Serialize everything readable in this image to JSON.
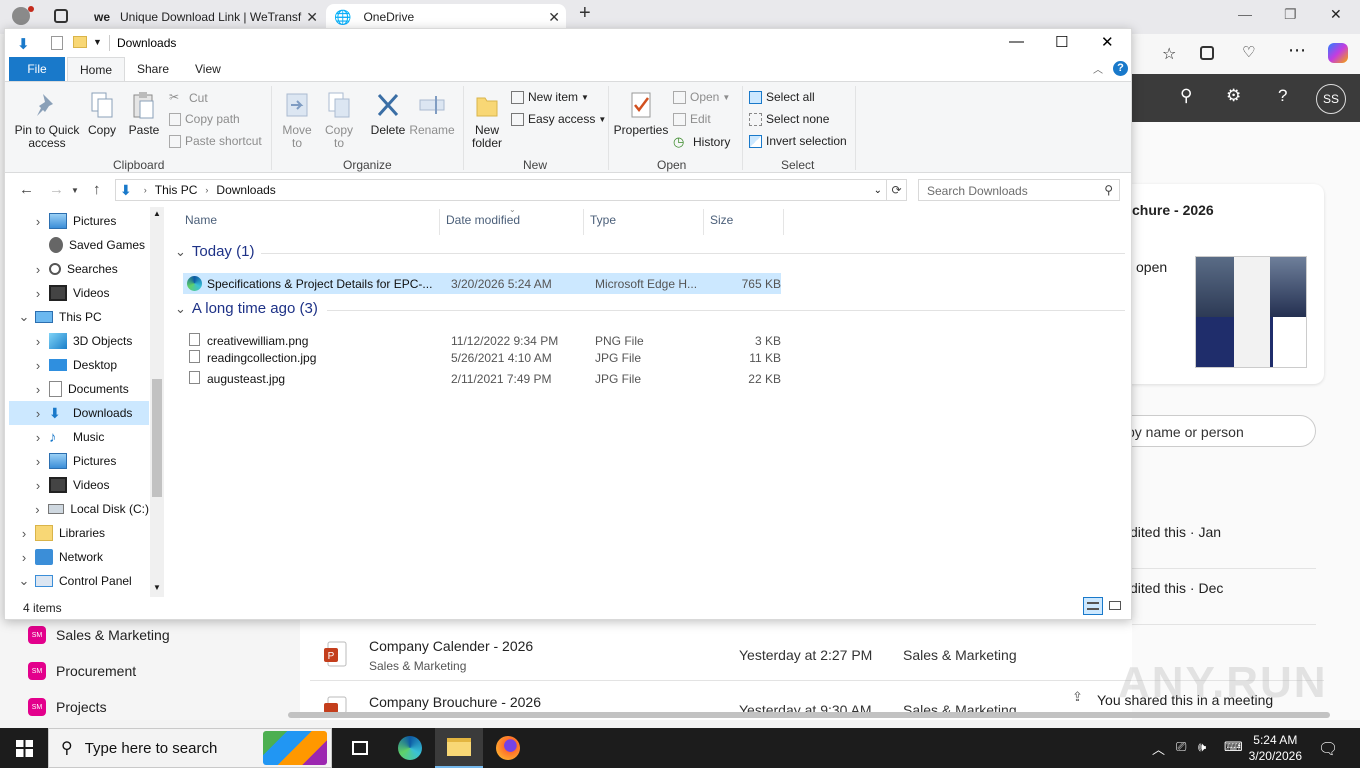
{
  "browser": {
    "tabs": [
      {
        "title": "Unique Download Link | WeTransf",
        "logo": "we"
      },
      {
        "title": "OneDrive"
      }
    ],
    "new_tab": "+",
    "window_controls": [
      "—",
      "❐",
      "✕"
    ]
  },
  "onedrive": {
    "avatar": "SS",
    "card_title": "chure - 2026",
    "card_action": "open",
    "search_placeholder": "by name or person",
    "activity": [
      "dited this · Jan",
      "dited this · Dec"
    ],
    "nav": [
      {
        "badge": "SM",
        "label": "Sales & Marketing"
      },
      {
        "badge": "SM",
        "label": "Procurement"
      },
      {
        "badge": "SM",
        "label": "Projects"
      }
    ],
    "files": [
      {
        "name": "Company Calender - 2026",
        "location": "Sales & Marketing",
        "modified": "Yesterday at 2:27 PM",
        "site": "Sales & Marketing"
      },
      {
        "name": "Company Brouchure - 2026",
        "location": "",
        "modified": "Yesterday at 9:30 AM",
        "site": "Sales & Marketing"
      }
    ],
    "shared_note": "You shared this in a meeting"
  },
  "explorer": {
    "title": "Downloads",
    "window_controls": [
      "—",
      "☐",
      "✕"
    ],
    "ribbon_tabs": [
      "File",
      "Home",
      "Share",
      "View"
    ],
    "ribbon": {
      "clipboard": {
        "label": "Clipboard",
        "pin": "Pin to Quick access",
        "copy": "Copy",
        "paste": "Paste",
        "cut": "Cut",
        "copy_path": "Copy path",
        "paste_shortcut": "Paste shortcut"
      },
      "organize": {
        "label": "Organize",
        "move_to": "Move to",
        "copy_to": "Copy to",
        "delete": "Delete",
        "rename": "Rename"
      },
      "new": {
        "label": "New",
        "new_folder": "New folder",
        "new_item": "New item",
        "easy_access": "Easy access"
      },
      "open": {
        "label": "Open",
        "properties": "Properties",
        "open": "Open",
        "edit": "Edit",
        "history": "History"
      },
      "select": {
        "label": "Select",
        "select_all": "Select all",
        "select_none": "Select none",
        "invert_selection": "Invert selection"
      }
    },
    "address": {
      "crumbs": [
        "This PC",
        "Downloads"
      ],
      "search_placeholder": "Search Downloads"
    },
    "nav_pane": [
      {
        "label": "Pictures",
        "indent": 1,
        "expander": true,
        "icon": "pictures"
      },
      {
        "label": "Saved Games",
        "indent": 1,
        "expander": false,
        "icon": "games"
      },
      {
        "label": "Searches",
        "indent": 1,
        "expander": true,
        "icon": "search"
      },
      {
        "label": "Videos",
        "indent": 1,
        "expander": true,
        "icon": "videos"
      },
      {
        "label": "This PC",
        "indent": 0,
        "expander": "open",
        "icon": "pc"
      },
      {
        "label": "3D Objects",
        "indent": 1,
        "expander": true,
        "icon": "3d"
      },
      {
        "label": "Desktop",
        "indent": 1,
        "expander": true,
        "icon": "desktop"
      },
      {
        "label": "Documents",
        "indent": 1,
        "expander": true,
        "icon": "documents"
      },
      {
        "label": "Downloads",
        "indent": 1,
        "expander": true,
        "icon": "downloads",
        "selected": true
      },
      {
        "label": "Music",
        "indent": 1,
        "expander": true,
        "icon": "music"
      },
      {
        "label": "Pictures",
        "indent": 1,
        "expander": true,
        "icon": "pictures"
      },
      {
        "label": "Videos",
        "indent": 1,
        "expander": true,
        "icon": "videos"
      },
      {
        "label": "Local Disk (C:)",
        "indent": 1,
        "expander": true,
        "icon": "disk"
      },
      {
        "label": "Libraries",
        "indent": 0,
        "expander": true,
        "icon": "libraries"
      },
      {
        "label": "Network",
        "indent": 0,
        "expander": true,
        "icon": "network"
      },
      {
        "label": "Control Panel",
        "indent": 0,
        "expander": "open",
        "icon": "control"
      }
    ],
    "columns": [
      "Name",
      "Date modified",
      "Type",
      "Size"
    ],
    "groups": [
      {
        "title": "Today (1)",
        "files": [
          {
            "name": "Specifications & Project Details for  EPC-...",
            "date": "3/20/2026 5:24 AM",
            "type": "Microsoft Edge H...",
            "size": "765 KB",
            "icon": "edge",
            "selected": true
          }
        ]
      },
      {
        "title": "A long time ago (3)",
        "files": [
          {
            "name": "creativewilliam.png",
            "date": "11/12/2022 9:34 PM",
            "type": "PNG File",
            "size": "3 KB",
            "icon": "file"
          },
          {
            "name": "readingcollection.jpg",
            "date": "5/26/2021 4:10 AM",
            "type": "JPG File",
            "size": "11 KB",
            "icon": "file"
          },
          {
            "name": "augusteast.jpg",
            "date": "2/11/2021 7:49 PM",
            "type": "JPG File",
            "size": "22 KB",
            "icon": "file"
          }
        ]
      }
    ],
    "status": "4 items"
  },
  "taskbar": {
    "search_placeholder": "Type here to search",
    "time": "5:24 AM",
    "date": "3/20/2026"
  },
  "colors": {
    "accent": "#1979ca",
    "selection": "#cce8ff",
    "group_title": "#1e3287",
    "onedrive_badge": "#e3008c"
  }
}
